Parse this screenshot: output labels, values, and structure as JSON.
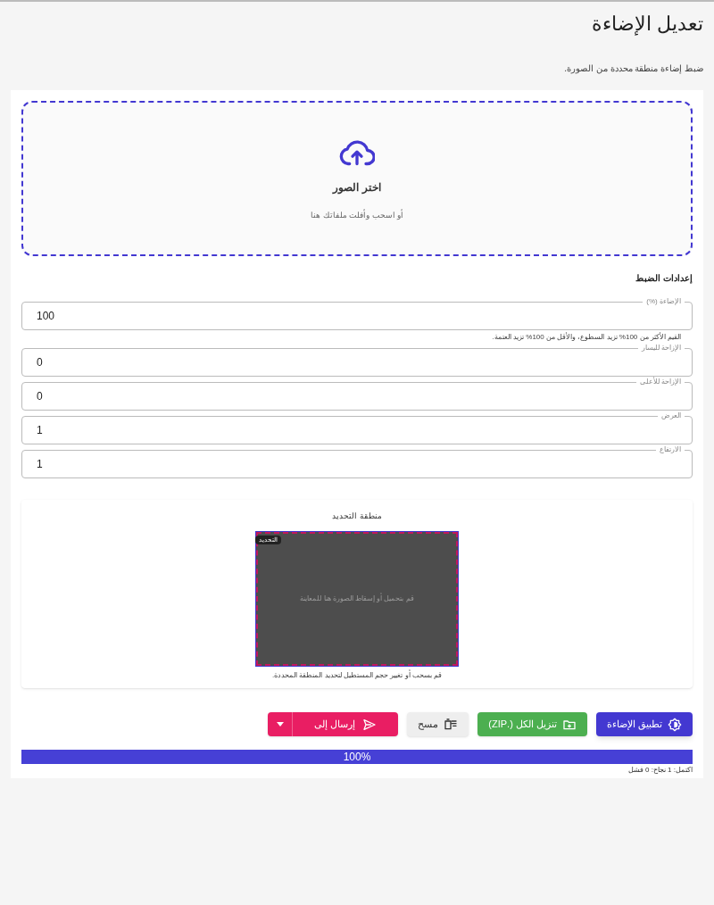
{
  "title": "تعديل الإضاءة",
  "subtitle": "ضبط إضاءة منطقة محددة من الصورة.",
  "upload": {
    "title": "اختر الصور",
    "hint": "أو اسحب وأفلت ملفاتك هنا"
  },
  "settings_heading": "إعدادات الضبط",
  "fields": [
    {
      "label": "الإضاءة (%)",
      "value": "100",
      "helper": "القيم الأكثر من 100% تزيد السطوع، والأقل من 100% تزيد العتمة."
    },
    {
      "label": "الإزاحة لليسار",
      "value": "0"
    },
    {
      "label": "الإزاحة للأعلى",
      "value": "0"
    },
    {
      "label": "العرض",
      "value": "1"
    },
    {
      "label": "الارتفاع",
      "value": "1"
    }
  ],
  "preview": {
    "title": "منطقة التحديد",
    "badge": "التحديد",
    "placeholder": "قم بتحميل أو إسقاط الصورة هنا للمعاينة",
    "hint": "قم بسحب أو تغيير حجم المستطيل لتحديد المنطقة المحددة."
  },
  "buttons": [
    {
      "kind": "primary",
      "label": "تطبيق الإضاءة"
    },
    {
      "kind": "success",
      "label": "تنزيل الكل (.ZIP)"
    },
    {
      "kind": "neutral",
      "label": "مسح"
    },
    {
      "kind": "split",
      "label": "إرسال إلى"
    }
  ],
  "progress": {
    "level": 1,
    "reading": "100%"
  },
  "status": "اكتمل: 1 نجاح: 0 فشل"
}
